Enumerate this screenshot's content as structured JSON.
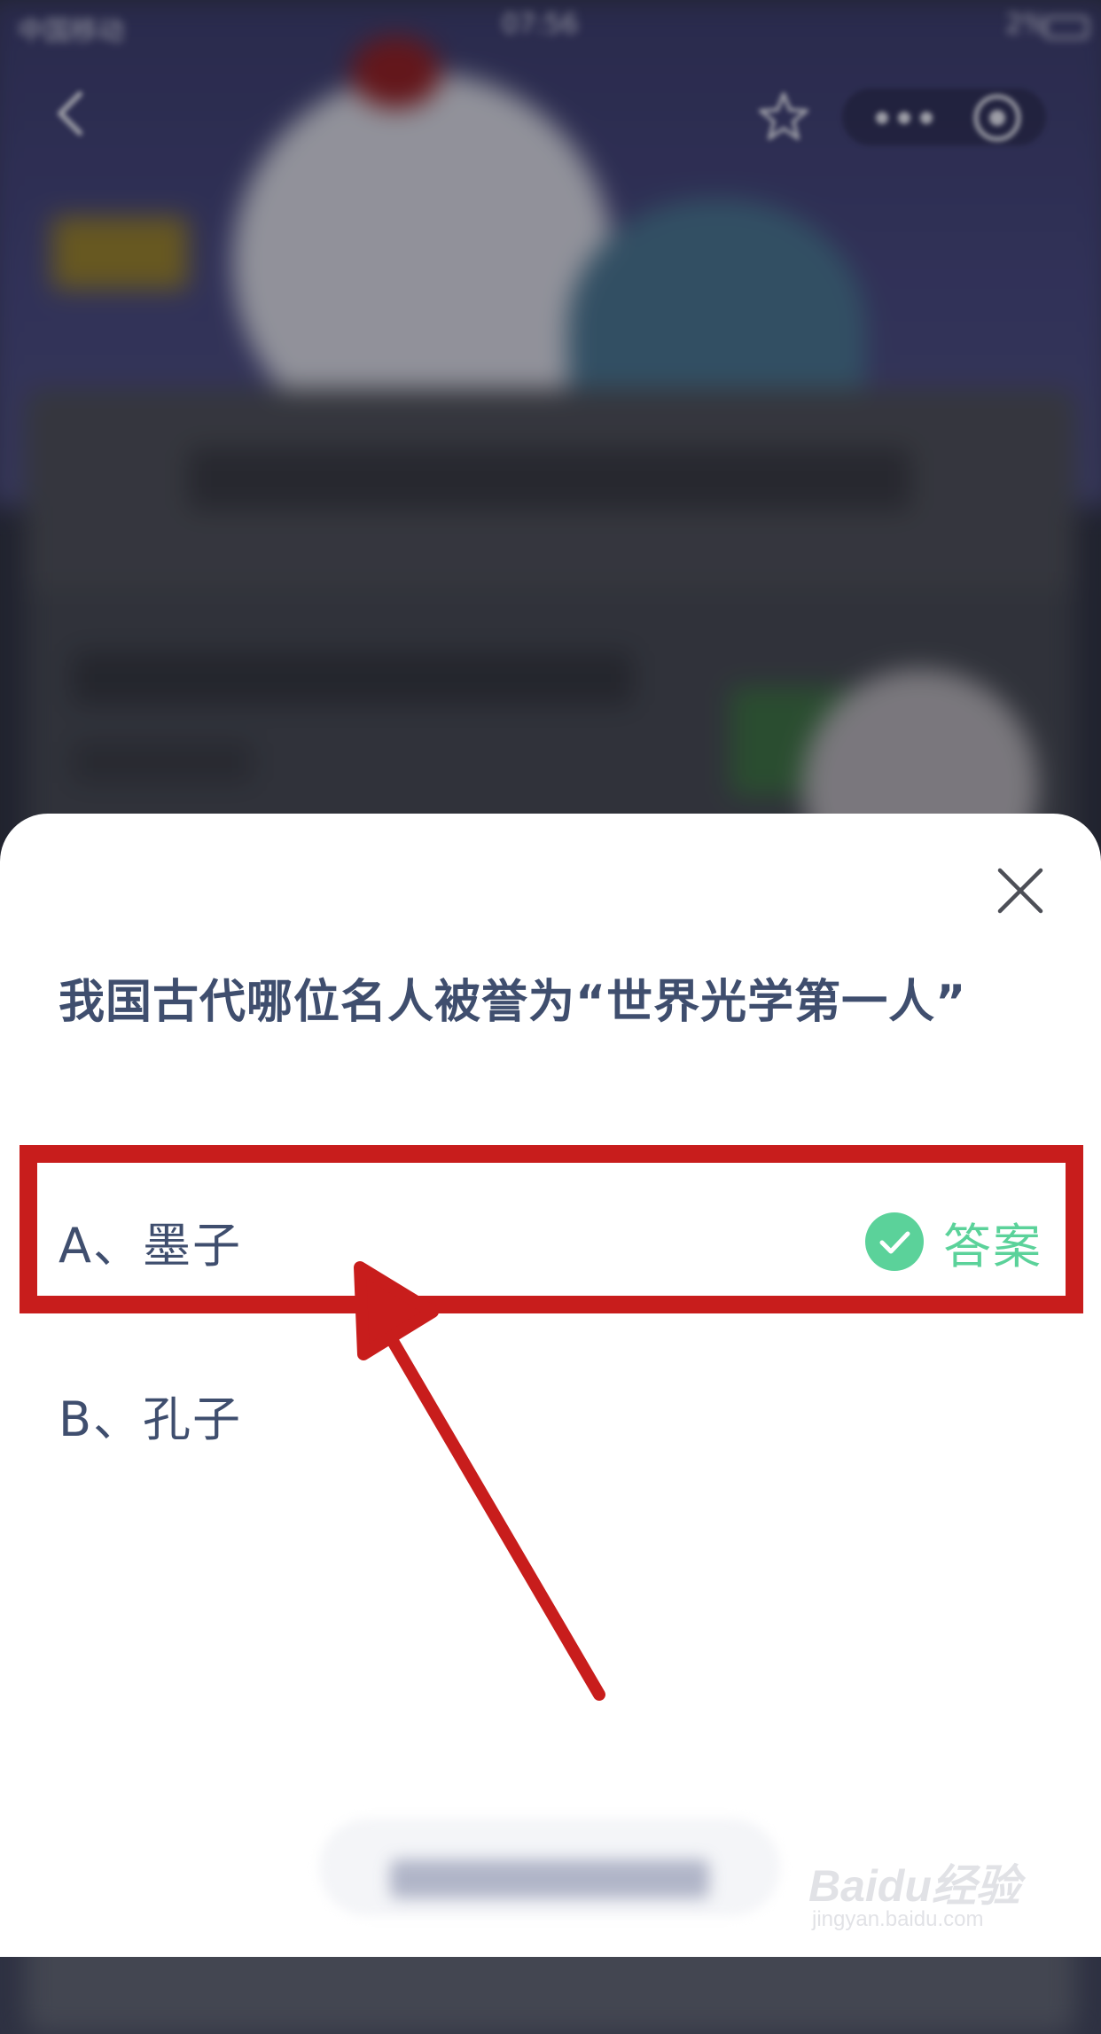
{
  "status_bar": {
    "carrier": "中国移动",
    "time": "07:56",
    "battery": "2%"
  },
  "question": {
    "text": "我国古代哪位名人被誉为“世界光学第一人”"
  },
  "options": [
    {
      "label": "A、墨子",
      "is_answer": true,
      "answer_text": "答案"
    },
    {
      "label": "B、孔子",
      "is_answer": false
    }
  ],
  "colors": {
    "question_text": "#3f4e6e",
    "answer_green": "#5bd29a",
    "highlight_red": "#c81d1c",
    "sheet_bg": "#ffffff"
  },
  "icons": {
    "close": "close-icon",
    "answer_check": "check-circle-icon",
    "back": "chevron-left-icon",
    "favorite": "star-icon",
    "more": "more-dots-icon",
    "record": "record-icon"
  },
  "watermark": {
    "main": "Baidu经验",
    "sub": "jingyan.baidu.com"
  }
}
